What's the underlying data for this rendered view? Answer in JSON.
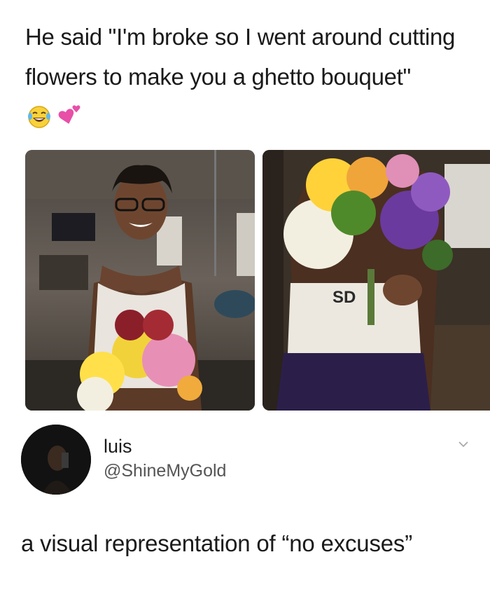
{
  "post": {
    "caption": "He said \"I'm broke so I went around cutting flowers to make you a ghetto bouquet\"",
    "caption_emojis": [
      "laughing-tears-emoji",
      "two-hearts-emoji"
    ],
    "photos": [
      {
        "name": "man-smiling-with-bouquet-photo"
      },
      {
        "name": "bouquet-covering-face-photo",
        "shirt_text": "SD"
      }
    ]
  },
  "tweet": {
    "author_name": "luis",
    "author_handle": "@ShineMyGold",
    "text": "a visual representation of “no excuses”",
    "menu_icon": "chevron-down-icon"
  },
  "colors": {
    "text": "#1a1a1a",
    "handle": "#555555",
    "background": "#ffffff"
  }
}
